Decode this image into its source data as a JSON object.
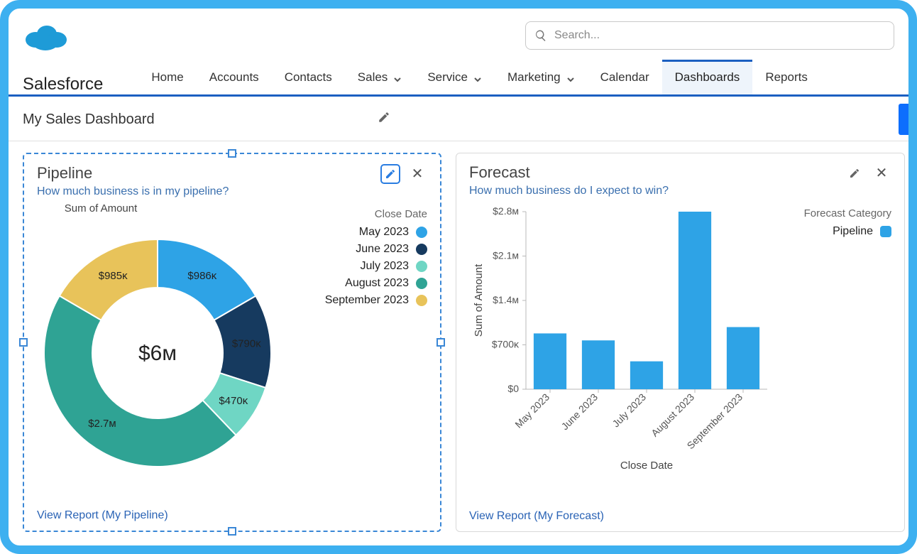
{
  "brand": "Salesforce",
  "search": {
    "placeholder": "Search..."
  },
  "nav": {
    "items": [
      {
        "label": "Home",
        "dropdown": false
      },
      {
        "label": "Accounts",
        "dropdown": false
      },
      {
        "label": "Contacts",
        "dropdown": false
      },
      {
        "label": "Sales",
        "dropdown": true
      },
      {
        "label": "Service",
        "dropdown": true
      },
      {
        "label": "Marketing",
        "dropdown": true
      },
      {
        "label": "Calendar",
        "dropdown": false
      },
      {
        "label": "Dashboards",
        "dropdown": false,
        "active": true
      },
      {
        "label": "Reports",
        "dropdown": false
      }
    ]
  },
  "dashboard": {
    "title": "My Sales Dashboard"
  },
  "pipeline": {
    "title": "Pipeline",
    "subtitle": "How much business is in my pipeline?",
    "chart_title": "Sum of Amount",
    "legend_title": "Close Date",
    "center_label": "$6ᴍ",
    "slices": [
      {
        "label": "May 2023",
        "value": 986000,
        "display": "$986ᴋ",
        "color": "#2ea3e6"
      },
      {
        "label": "June 2023",
        "value": 790000,
        "display": "$790ᴋ",
        "color": "#163a5f"
      },
      {
        "label": "July 2023",
        "value": 470000,
        "display": "$470ᴋ",
        "color": "#6fd6c4"
      },
      {
        "label": "August 2023",
        "value": 2700000,
        "display": "$2.7ᴍ",
        "color": "#2fa394"
      },
      {
        "label": "September 2023",
        "value": 985000,
        "display": "$985ᴋ",
        "color": "#e8c35a"
      }
    ],
    "view_link": "View Report (My Pipeline)"
  },
  "forecast": {
    "title": "Forecast",
    "subtitle": "How much business do I expect to win?",
    "legend_title": "Forecast Category",
    "legend_item": "Pipeline",
    "y_title": "Sum of Amount",
    "x_title": "Close Date",
    "y_ticks": [
      "$0",
      "$700ᴋ",
      "$1.4ᴍ",
      "$2.1ᴍ",
      "$2.8ᴍ"
    ],
    "bars": [
      {
        "label": "May 2023",
        "value": 880000
      },
      {
        "label": "June 2023",
        "value": 770000
      },
      {
        "label": "July 2023",
        "value": 440000
      },
      {
        "label": "August 2023",
        "value": 2800000
      },
      {
        "label": "September 2023",
        "value": 980000
      }
    ],
    "bar_color": "#2ea3e6",
    "view_link": "View Report (My Forecast)"
  },
  "chart_data": [
    {
      "type": "pie",
      "title": "Sum of Amount",
      "categories": [
        "May 2023",
        "June 2023",
        "July 2023",
        "August 2023",
        "September 2023"
      ],
      "values": [
        986000,
        790000,
        470000,
        2700000,
        985000
      ],
      "total_label": "$6M",
      "legend_title": "Close Date"
    },
    {
      "type": "bar",
      "title": "Forecast",
      "xlabel": "Close Date",
      "ylabel": "Sum of Amount",
      "categories": [
        "May 2023",
        "June 2023",
        "July 2023",
        "August 2023",
        "September 2023"
      ],
      "values": [
        880000,
        770000,
        440000,
        2800000,
        980000
      ],
      "ylim": [
        0,
        2800000
      ],
      "series_name": "Pipeline"
    }
  ]
}
